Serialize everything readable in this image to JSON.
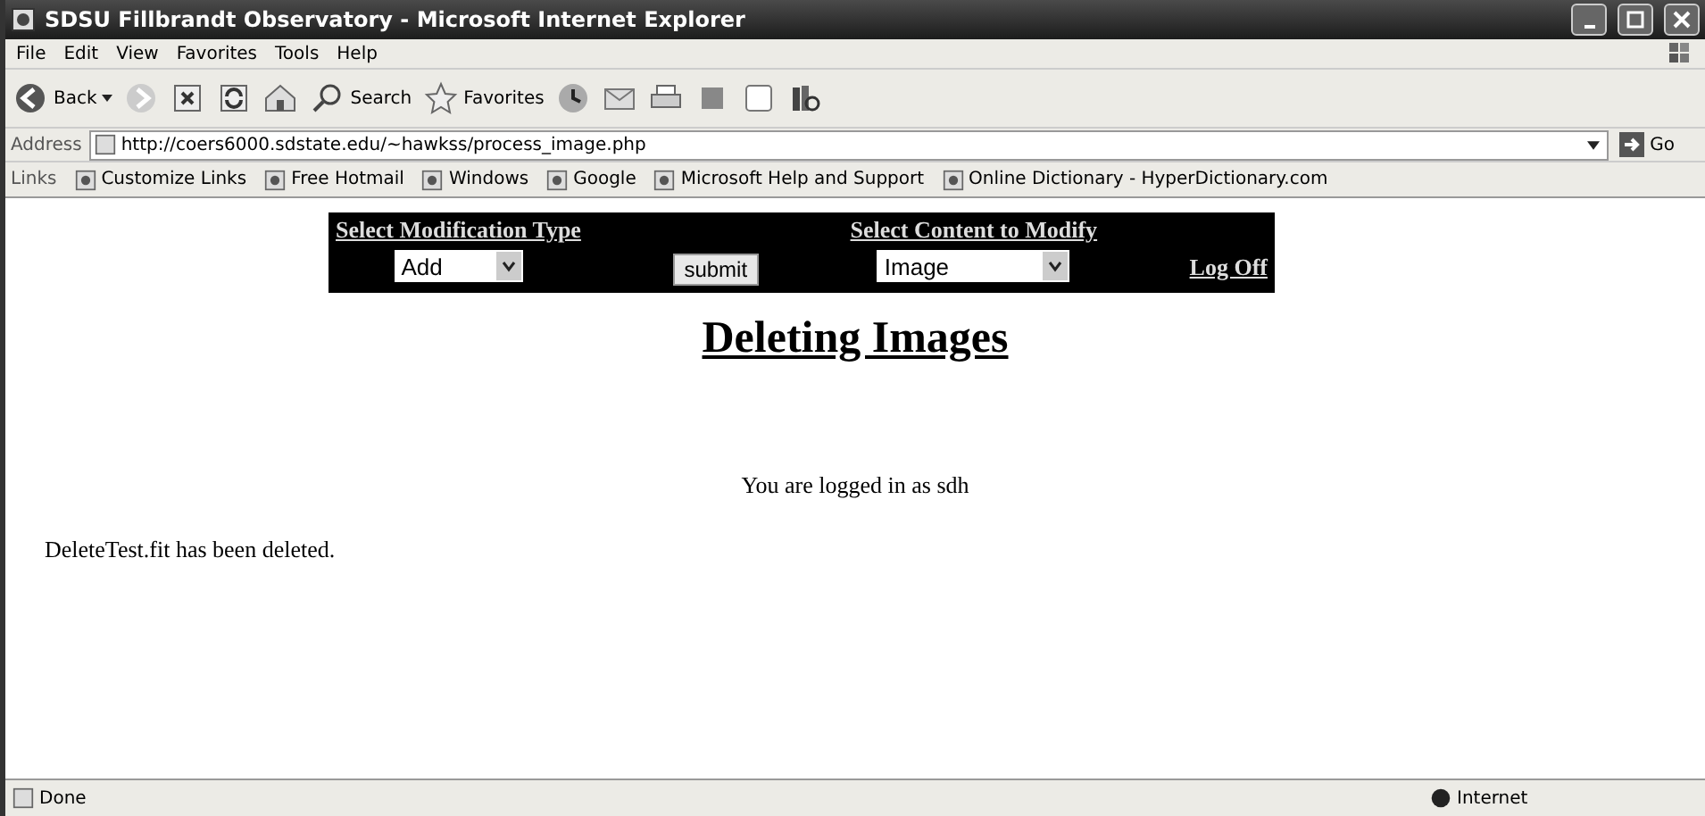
{
  "window": {
    "title": "SDSU Fillbrandt Observatory - Microsoft Internet Explorer"
  },
  "menu": [
    "File",
    "Edit",
    "View",
    "Favorites",
    "Tools",
    "Help"
  ],
  "toolbar": [
    {
      "kind": "back",
      "label": "Back"
    },
    {
      "kind": "forward"
    },
    {
      "kind": "stop"
    },
    {
      "kind": "refresh"
    },
    {
      "kind": "home"
    },
    {
      "kind": "search",
      "label": "Search"
    },
    {
      "kind": "favorites",
      "label": "Favorites"
    },
    {
      "kind": "history"
    },
    {
      "kind": "mail"
    },
    {
      "kind": "print"
    },
    {
      "kind": "edit"
    },
    {
      "kind": "discuss"
    },
    {
      "kind": "research"
    }
  ],
  "address": {
    "label": "Address",
    "value": "http://coers6000.sdstate.edu/~hawkss/process_image.php",
    "go": "Go"
  },
  "links": {
    "label": "Links",
    "items": [
      "Customize Links",
      "Free Hotmail",
      "Windows",
      "Google",
      "Microsoft Help and Support",
      "Online Dictionary - HyperDictionary.com"
    ]
  },
  "nav": {
    "modification_heading": "Select Modification Type",
    "content_heading": "Select Content to Modify",
    "modification_value": "Add",
    "submit": "submit",
    "content_value": "Image",
    "logoff": "Log Off"
  },
  "heading": "Deleting Images",
  "login_note": "You are logged in as sdh",
  "message": "DeleteTest.fit has been deleted.",
  "status_bar": {
    "text": "Done",
    "zone": "Internet"
  }
}
